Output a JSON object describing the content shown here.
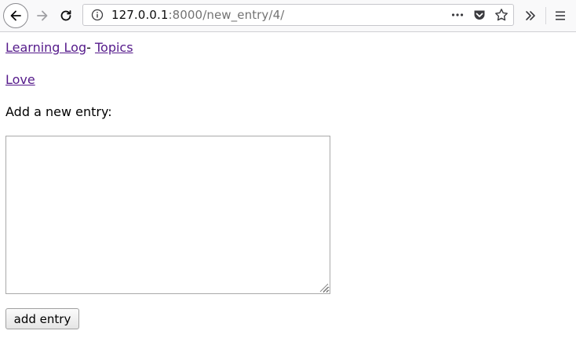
{
  "browser": {
    "url_host": "127.0.0.1",
    "url_path": ":8000/new_entry/4/",
    "icons": {
      "back": "arrow-left-icon",
      "forward": "arrow-right-icon",
      "reload": "reload-icon",
      "info": "info-icon",
      "more": "more-dots-icon",
      "pocket": "pocket-icon",
      "bookmark": "star-icon",
      "overflow": "double-chevron-icon",
      "menu": "hamburger-menu-icon"
    }
  },
  "page": {
    "header": {
      "home_link": "Learning Log",
      "separator": "- ",
      "topics_link": "Topics"
    },
    "topic_link": "Love",
    "form_label": "Add a new entry:",
    "entry_text": "",
    "submit_label": "add entry"
  },
  "colors": {
    "visited_link": "#551a8b",
    "chrome_bg": "#f9f9fa"
  }
}
